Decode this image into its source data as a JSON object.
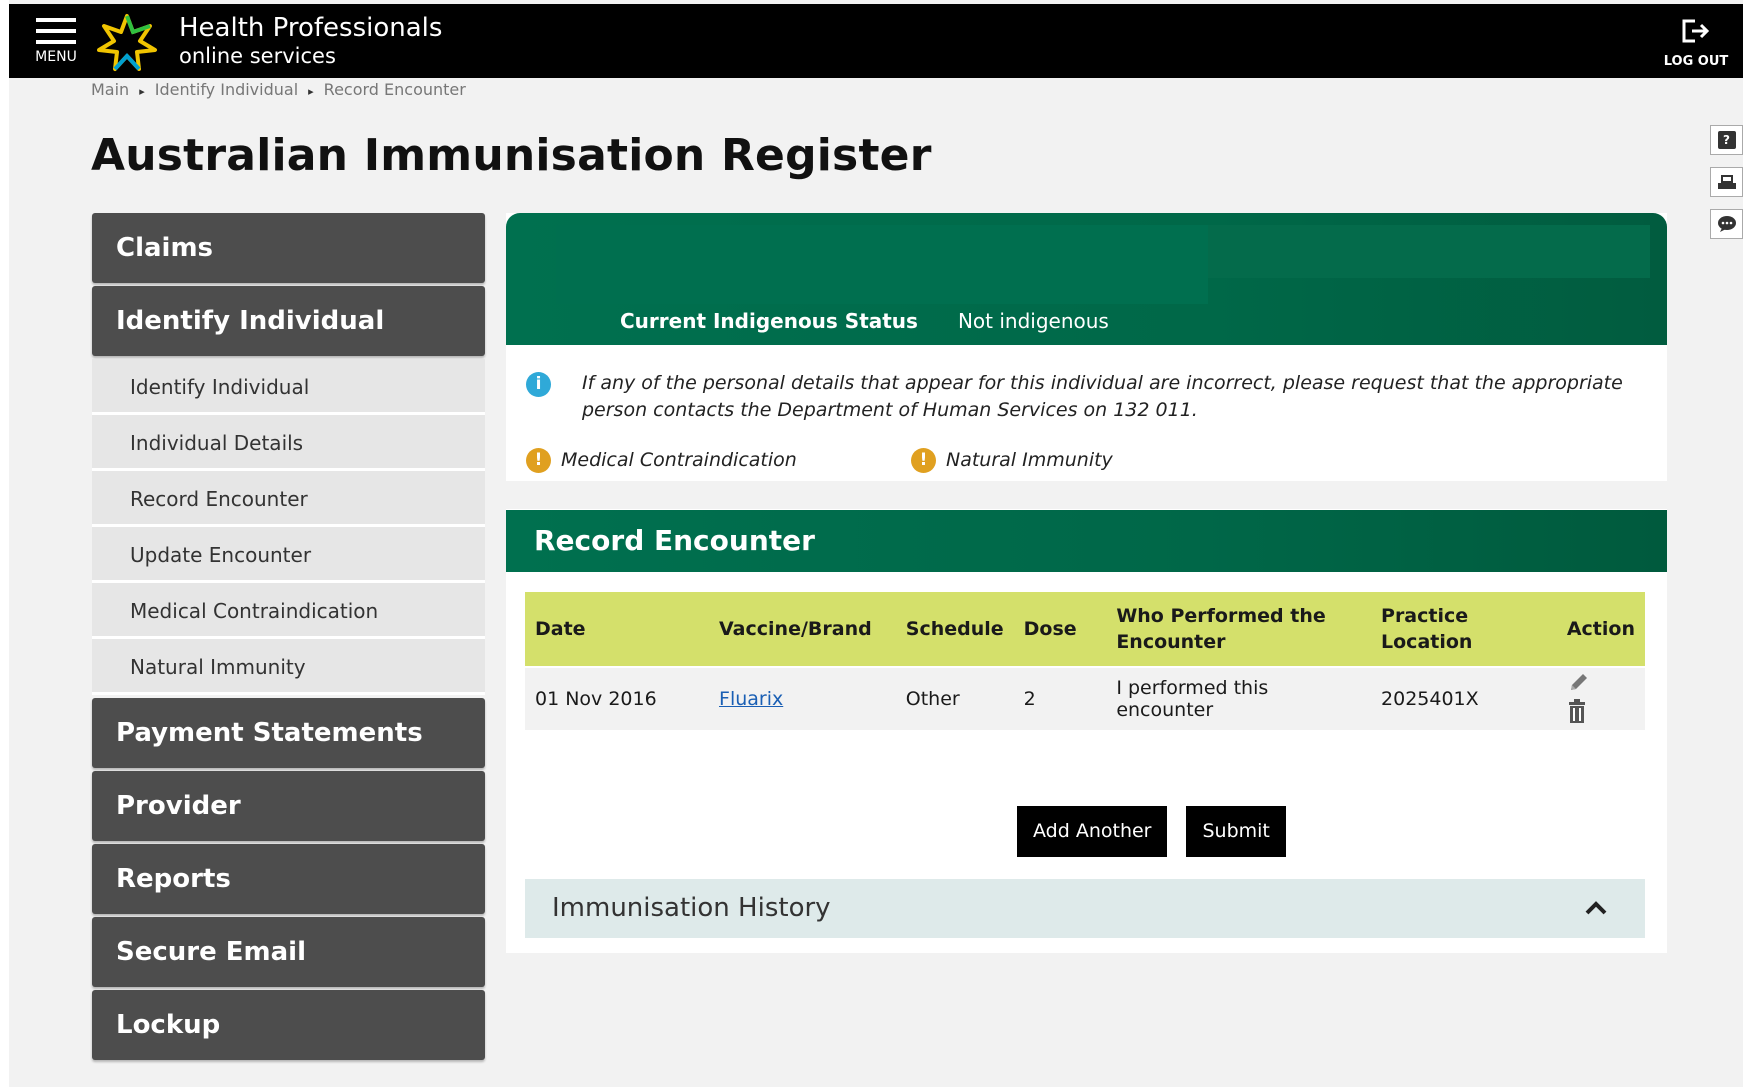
{
  "header": {
    "menu_label": "MENU",
    "brand_line1": "Health Professionals",
    "brand_line2": "online services",
    "logout_label": "LOG OUT"
  },
  "breadcrumb": [
    "Main",
    "Identify Individual",
    "Record Encounter"
  ],
  "page_title": "Australian Immunisation Register",
  "side_tools": [
    "?",
    "",
    ""
  ],
  "nav": {
    "claims": "Claims",
    "identify": "Identify Individual",
    "sub": [
      "Identify Individual",
      "Individual Details",
      "Record Encounter",
      "Update Encounter",
      "Medical Contraindication",
      "Natural Immunity"
    ],
    "payment": "Payment Statements",
    "provider": "Provider",
    "reports": "Reports",
    "secure_email": "Secure Email",
    "lockup": "Lockup"
  },
  "individual": {
    "indigenous_label": "Current Indigenous Status",
    "indigenous_value": "Not indigenous",
    "info_text": "If any of the personal details that appear for this individual are incorrect, please request that the appropriate person contacts the Department of Human Services on 132 011.",
    "alerts": [
      "Medical Contraindication",
      "Natural Immunity"
    ]
  },
  "record_encounter": {
    "title": "Record Encounter",
    "columns": [
      "Date",
      "Vaccine/Brand",
      "Schedule",
      "Dose",
      "Who Performed the Encounter",
      "Practice Location",
      "Action"
    ],
    "rows": [
      {
        "date": "01 Nov 2016",
        "vaccine": "Fluarix",
        "schedule": "Other",
        "dose": "2",
        "who": "I performed this encounter",
        "location": "2025401X"
      }
    ],
    "add_another": "Add Another",
    "submit": "Submit"
  },
  "history": {
    "title": "Immunisation History"
  },
  "colors": {
    "green": "#00704f",
    "table_header": "#d4e06b",
    "nav_dark": "#4d4d4d"
  }
}
